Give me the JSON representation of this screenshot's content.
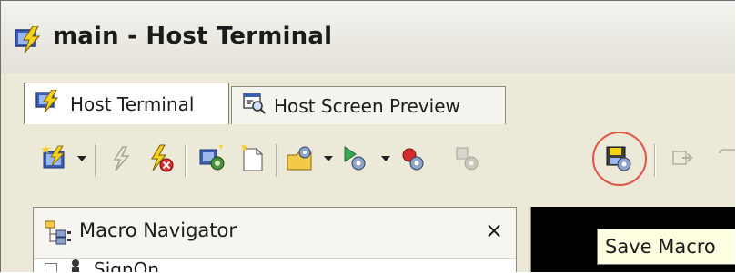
{
  "window": {
    "title": "main - Host Terminal"
  },
  "tabs": [
    {
      "label": "Host Terminal",
      "icon": "lightning-icon",
      "active": true
    },
    {
      "label": "Host Screen Preview",
      "icon": "screen-preview-icon",
      "active": false
    }
  ],
  "toolbar": {
    "buttons": [
      "new-connection-icon",
      "disconnect-icon",
      "stop-connection-icon",
      "screen-capture-icon",
      "new-screen-icon",
      "open-macro-icon",
      "play-macro-icon",
      "record-macro-icon",
      "macro-settings-icon",
      "save-macro-icon",
      "step-icon"
    ],
    "highlighted_button": "save-macro-icon",
    "highlight_color": "#e05545"
  },
  "macro_navigator": {
    "title": "Macro Navigator",
    "close_label": "×",
    "items": [
      {
        "label": "SignOn"
      }
    ]
  },
  "tooltip": {
    "text": "Save Macro"
  },
  "colors": {
    "chrome": "#ece9d8",
    "terminal_bg": "#000000",
    "tooltip_bg": "#ffffe1"
  }
}
